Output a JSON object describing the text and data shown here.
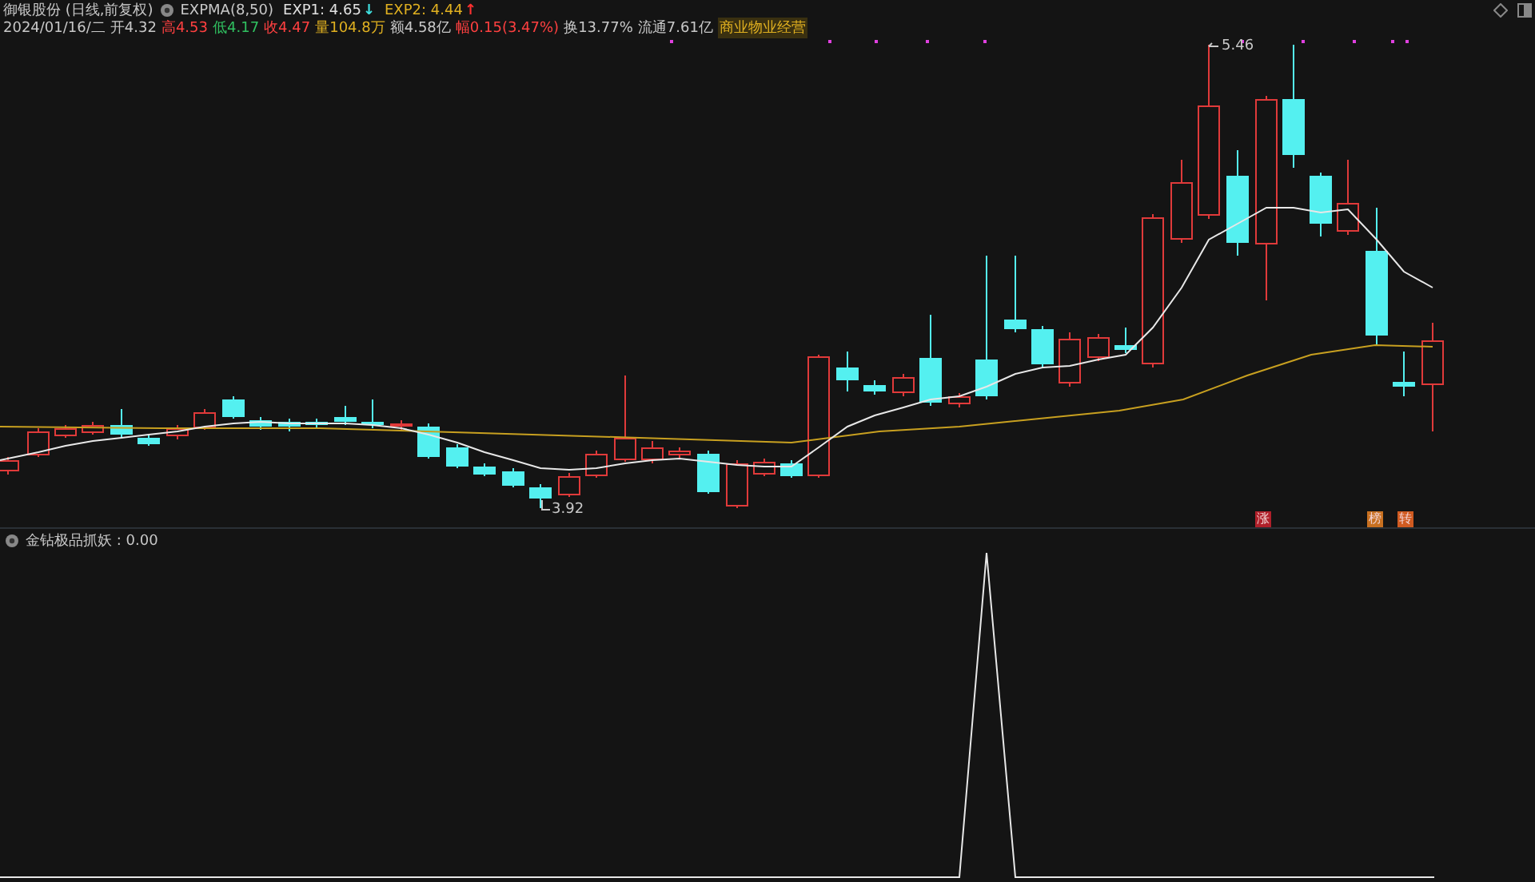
{
  "header": {
    "title": "御银股份 (日线,前复权)",
    "indicator": "EXPMA(8,50)",
    "exp": [
      {
        "label": "EXP1: 4.65",
        "color": "#e0e0e0",
        "arrow": {
          "symbol": "↓",
          "color": "#40e0e0"
        }
      },
      {
        "label": "EXP2: 4.44",
        "color": "#e0b020",
        "arrow": {
          "symbol": "↑",
          "color": "#ff3030"
        }
      }
    ]
  },
  "quote": [
    {
      "text": "2024/01/16/二",
      "color": "#c8c8c8"
    },
    {
      "text": "开4.32",
      "color": "#c8c8c8"
    },
    {
      "text": "高4.53",
      "color": "#ff4040"
    },
    {
      "text": "低4.17",
      "color": "#30c060"
    },
    {
      "text": "收4.47",
      "color": "#ff4040"
    },
    {
      "text": "量104.8万",
      "color": "#e0b020"
    },
    {
      "text": "额4.58亿",
      "color": "#c8c8c8"
    },
    {
      "text": "幅0.15(3.47%)",
      "color": "#ff4040"
    },
    {
      "text": "换13.77%",
      "color": "#c8c8c8"
    },
    {
      "text": "流通7.61亿",
      "color": "#c8c8c8"
    }
  ],
  "sector_tag": "商业物业经营",
  "price_labels": [
    {
      "text": "5.46",
      "kind": "high"
    },
    {
      "text": "3.92",
      "kind": "low"
    }
  ],
  "badges": [
    {
      "text": "涨",
      "color": "#b0202a"
    },
    {
      "text": "榜",
      "color": "#c87020"
    },
    {
      "text": "转",
      "color": "#d05a20"
    }
  ],
  "lower_panel": {
    "title": "金钻极品抓妖 : 0.00"
  }
}
